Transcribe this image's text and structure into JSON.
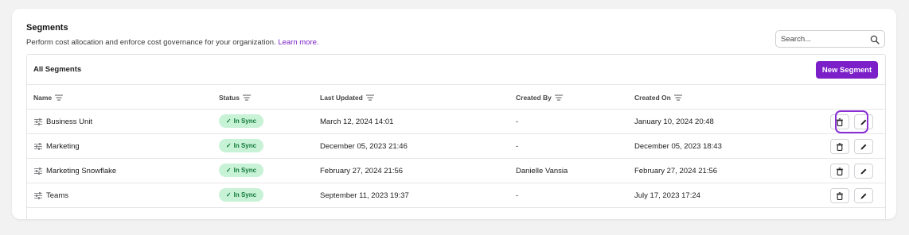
{
  "header": {
    "title": "Segments",
    "subtitle": "Perform cost allocation and enforce cost governance for your organization.",
    "learn_more": "Learn more.",
    "search_placeholder": "Search..."
  },
  "panel": {
    "title": "All Segments",
    "new_button": "New Segment"
  },
  "columns": {
    "name": "Name",
    "status": "Status",
    "last_updated": "Last Updated",
    "created_by": "Created By",
    "created_on": "Created On"
  },
  "rows": [
    {
      "name": "Business Unit",
      "status": "In Sync",
      "last_updated": "March 12, 2024 14:01",
      "created_by": "-",
      "created_on": "January 10, 2024 20:48"
    },
    {
      "name": "Marketing",
      "status": "In Sync",
      "last_updated": "December 05, 2023 21:46",
      "created_by": "-",
      "created_on": "December 05, 2023 18:43"
    },
    {
      "name": "Marketing Snowflake",
      "status": "In Sync",
      "last_updated": "February 27, 2024 21:56",
      "created_by": "Danielle Vansia",
      "created_on": "February 27, 2024 21:56"
    },
    {
      "name": "Teams",
      "status": "In Sync",
      "last_updated": "September 11, 2023 19:37",
      "created_by": "-",
      "created_on": "July 17, 2023 17:24"
    }
  ],
  "colors": {
    "accent": "#7b1fc9",
    "status_bg": "#c8f2d6",
    "status_text": "#137a3a"
  },
  "icons": {
    "search": "search-icon",
    "sort": "sort-icon",
    "segment": "sliders-icon",
    "delete": "trash-icon",
    "edit": "pencil-icon",
    "status": "check-icon"
  }
}
